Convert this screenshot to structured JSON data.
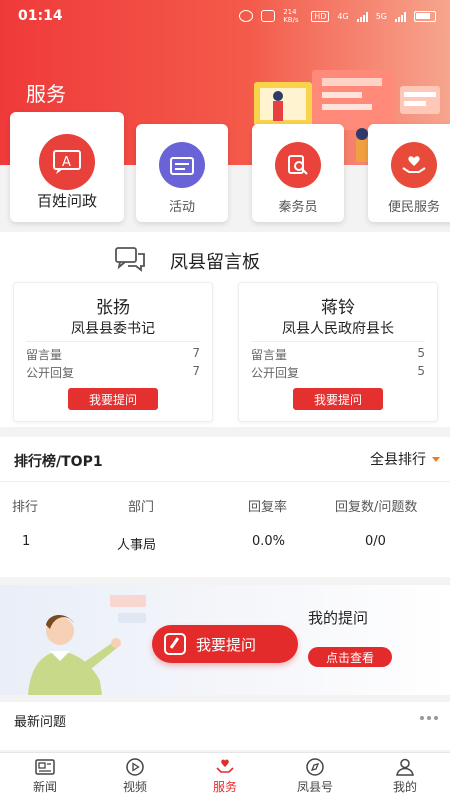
{
  "status_bar": {
    "time": "01:14",
    "net_speed": "214 KB/s",
    "hd": "HD",
    "network": "4G",
    "network2": "5G"
  },
  "header": {
    "title": "服务"
  },
  "services": [
    {
      "label": "百姓问政",
      "icon": "message-a-icon",
      "color": "#e8403a"
    },
    {
      "label": "活动",
      "icon": "calendar-icon",
      "color": "#6a63d8"
    },
    {
      "label": "秦务员",
      "icon": "search-doc-icon",
      "color": "#e9433b"
    },
    {
      "label": "便民服务",
      "icon": "heart-hands-icon",
      "color": "#e94b3a"
    }
  ],
  "board": {
    "title": "凤县留言板",
    "leaders": [
      {
        "name": "张扬",
        "role": "凤县县委书记",
        "stats": [
          {
            "label": "留言量",
            "value": "7"
          },
          {
            "label": "公开回复",
            "value": "7"
          }
        ],
        "button": "我要提问"
      },
      {
        "name": "蒋铃",
        "role": "凤县人民政府县长",
        "stats": [
          {
            "label": "留言量",
            "value": "5"
          },
          {
            "label": "公开回复",
            "value": "5"
          }
        ],
        "button": "我要提问"
      }
    ]
  },
  "ranking": {
    "title": "排行榜/TOP1",
    "filter": "全县排行",
    "columns": [
      "排行",
      "部门",
      "回复率",
      "回复数/问题数"
    ],
    "rows": [
      [
        "1",
        "人事局",
        "0.0%",
        "0/0"
      ]
    ]
  },
  "ask_banner": {
    "pill_label": "我要提问",
    "my_questions": "我的提问",
    "view_button": "点击查看"
  },
  "latest": {
    "title": "最新问题"
  },
  "tabbar": {
    "active": "服务",
    "tabs": [
      {
        "label": "新闻",
        "icon": "news-icon"
      },
      {
        "label": "视频",
        "icon": "play-icon"
      },
      {
        "label": "服务",
        "icon": "heart-service-icon"
      },
      {
        "label": "凤县号",
        "icon": "compass-icon"
      },
      {
        "label": "我的",
        "icon": "user-icon"
      }
    ]
  },
  "colors": {
    "accent": "#e42b2b",
    "header_start": "#ef3a3a",
    "header_end": "#f6a58e"
  }
}
